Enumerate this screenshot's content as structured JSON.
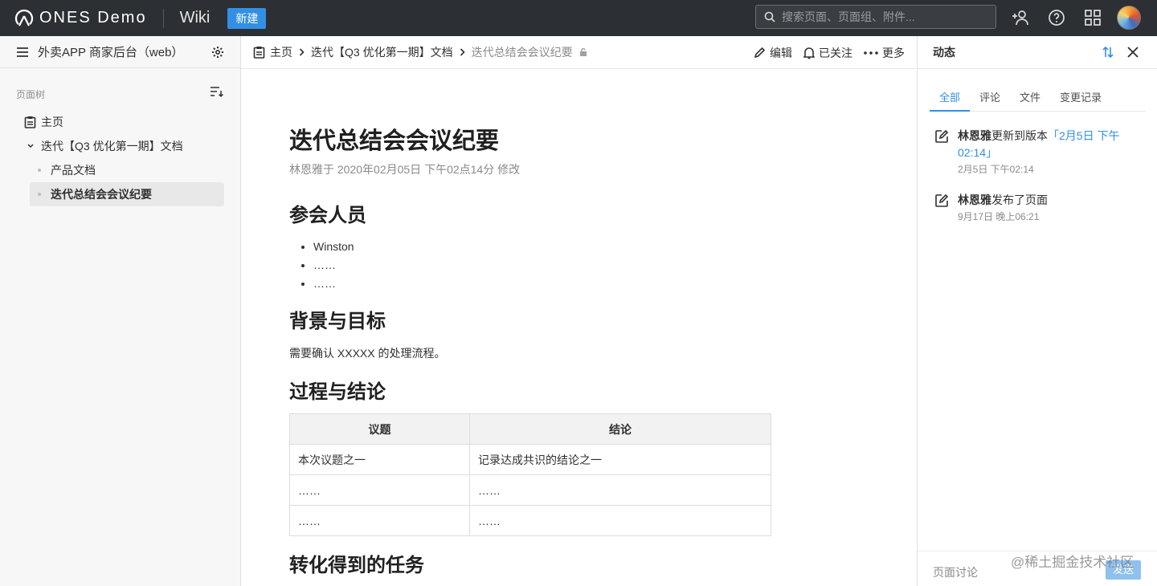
{
  "topbar": {
    "brand": "ONES Demo",
    "product": "Wiki",
    "new_button": "新建",
    "search_placeholder": "搜索页面、页面组、附件..."
  },
  "sidebar": {
    "space_title": "外卖APP 商家后台（web）",
    "tree_label": "页面树",
    "items": [
      {
        "label": "主页"
      },
      {
        "label": "迭代【Q3 优化第一期】文档"
      },
      {
        "label": "产品文档"
      },
      {
        "label": "迭代总结会会议纪要"
      }
    ]
  },
  "toolbar": {
    "breadcrumbs": [
      "主页",
      "迭代【Q3 优化第一期】文档",
      "迭代总结会会议纪要"
    ],
    "edit": "编辑",
    "watching": "已关注",
    "more": "更多"
  },
  "doc": {
    "title": "迭代总结会会议纪要",
    "meta": "林恩雅于 2020年02月05日 下午02点14分 修改",
    "h_attendees": "参会人员",
    "attendees": [
      "Winston",
      "……",
      "……"
    ],
    "h_background": "背景与目标",
    "background_text": "需要确认 XXXXX 的处理流程。",
    "h_process": "过程与结论",
    "table": {
      "headers": [
        "议题",
        "结论"
      ],
      "rows": [
        [
          "本次议题之一",
          "记录达成共识的结论之一"
        ],
        [
          "……",
          "……"
        ],
        [
          "……",
          "……"
        ]
      ]
    },
    "h_tasks": "转化得到的任务"
  },
  "activity": {
    "title": "动态",
    "tabs": [
      "全部",
      "评论",
      "文件",
      "变更记录"
    ],
    "active_tab": "全部",
    "items": [
      {
        "user": "林恩雅",
        "action": "更新到版本",
        "link": "「2月5日 下午02:14」",
        "time": "2月5日 下午02:14"
      },
      {
        "user": "林恩雅",
        "action": "发布了页面",
        "link": "",
        "time": "9月17日 晚上06:21"
      }
    ],
    "footer_label": "页面讨论",
    "send_button": "发送"
  },
  "watermark": "@稀土掘金技术社区",
  "colors": {
    "topbar": "#2c2f33",
    "accent": "#338fe5",
    "sidebar_bg": "#f7f7f7"
  }
}
